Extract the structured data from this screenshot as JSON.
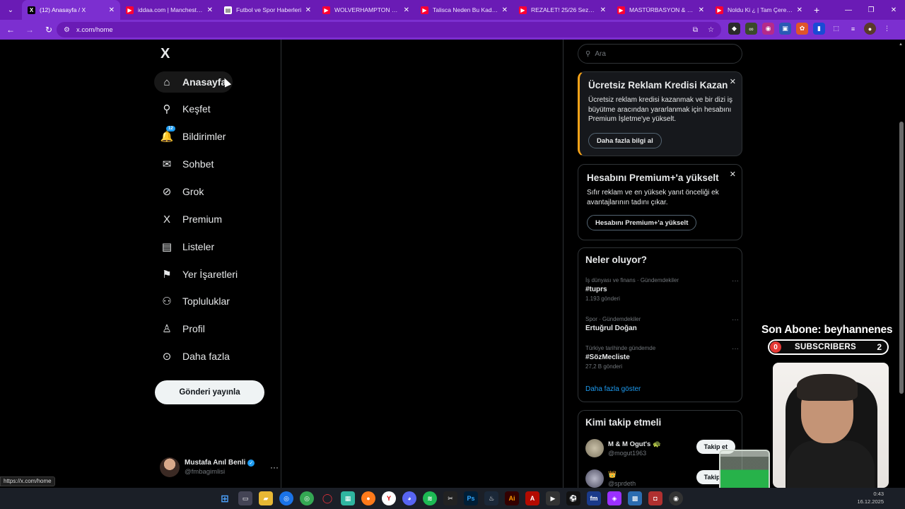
{
  "browser": {
    "tabs": [
      {
        "title": "(12) Anasayfa / X",
        "favicon": "x-icon",
        "color": "#000000",
        "active": true
      },
      {
        "title": "iddaa.com | Manchester U",
        "favicon": "youtube-icon",
        "color": "#ff0033"
      },
      {
        "title": "Futbol ve Spor Haberleri",
        "favicon": "news-icon",
        "color": "#ffffff"
      },
      {
        "title": "WOLVERHAMPTON PORT",
        "favicon": "youtube-icon",
        "color": "#ff0033"
      },
      {
        "title": "Talisca Neden Bu Kadar Ö",
        "favicon": "youtube-icon",
        "color": "#ff0033"
      },
      {
        "title": "REZALET! 25/26 Sezonun",
        "favicon": "youtube-icon",
        "color": "#ff0033"
      },
      {
        "title": "MASTÜRBASYON & ÇAY",
        "favicon": "youtube-icon",
        "color": "#ff0033"
      },
      {
        "title": "Noldu Ki ¿ | Tam Çerezlik",
        "favicon": "youtube-icon",
        "color": "#ff0033"
      }
    ],
    "new_tab": "+",
    "url": "x.com/home"
  },
  "sidebar": {
    "logo": "X",
    "items": [
      {
        "label": "Anasayfa",
        "icon": "home-icon",
        "glyph": "⌂",
        "active": true
      },
      {
        "label": "Keşfet",
        "icon": "search-icon",
        "glyph": "⚲"
      },
      {
        "label": "Bildirimler",
        "icon": "bell-icon",
        "glyph": "🔔",
        "badge": "12"
      },
      {
        "label": "Sohbet",
        "icon": "mail-icon",
        "glyph": "✉"
      },
      {
        "label": "Grok",
        "icon": "grok-icon",
        "glyph": "⊘"
      },
      {
        "label": "Premium",
        "icon": "x-premium-icon",
        "glyph": "X"
      },
      {
        "label": "Listeler",
        "icon": "list-icon",
        "glyph": "▤"
      },
      {
        "label": "Yer İşaretleri",
        "icon": "bookmark-icon",
        "glyph": "⚑"
      },
      {
        "label": "Topluluklar",
        "icon": "communities-icon",
        "glyph": "⚇"
      },
      {
        "label": "Profil",
        "icon": "profile-icon",
        "glyph": "♙"
      },
      {
        "label": "Daha fazla",
        "icon": "more-circle-icon",
        "glyph": "⊙"
      }
    ],
    "post_button": "Gönderi yayınla",
    "account": {
      "name": "Mustafa Anıl Benli",
      "handle": "@fmbagimlisi"
    }
  },
  "right": {
    "search_placeholder": "Ara",
    "promo": {
      "title": "Ücretsiz Reklam Kredisi Kazan",
      "body": "Ücretsiz reklam kredisi kazanmak ve bir dizi iş büyütme aracından yararlanmak için hesabını Premium İşletme'ye yükselt.",
      "button": "Daha fazla bilgi al"
    },
    "premium": {
      "title": "Hesabını Premium+'a yükselt",
      "body": "Sıfır reklam ve en yüksek yanıt önceliği ek avantajlarının tadını çıkar.",
      "button": "Hesabını Premium+'a yükselt"
    },
    "trends": {
      "title": "Neler oluyor?",
      "items": [
        {
          "meta": "İş dünyası ve finans · Gündemdekiler",
          "name": "#tuprs",
          "count": "1.193 gönderi"
        },
        {
          "meta": "Spor · Gündemdekiler",
          "name": "Ertuğrul Doğan",
          "count": ""
        },
        {
          "meta": "Türkiye tarihinde gündemde",
          "name": "#SözMecliste",
          "count": "27,2 B gönderi"
        }
      ],
      "show_more": "Daha fazla göster"
    },
    "who_to_follow": {
      "title": "Kimi takip etmeli",
      "users": [
        {
          "name": "M & M Ogut's 🐢",
          "handle": "@mogut1963",
          "button": "Takip et"
        },
        {
          "name": "👑",
          "handle": "@sprdeth",
          "button": "Takip et"
        }
      ]
    }
  },
  "overlay": {
    "son_abone": "Son Abone: beyhannenes",
    "subscribers_label": "SUBSCRIBERS",
    "subscribers_left": "0",
    "subscribers_count": "2"
  },
  "status_link": "https://x.com/home",
  "clock": {
    "time": "0:43",
    "date": "16.12.2025"
  }
}
